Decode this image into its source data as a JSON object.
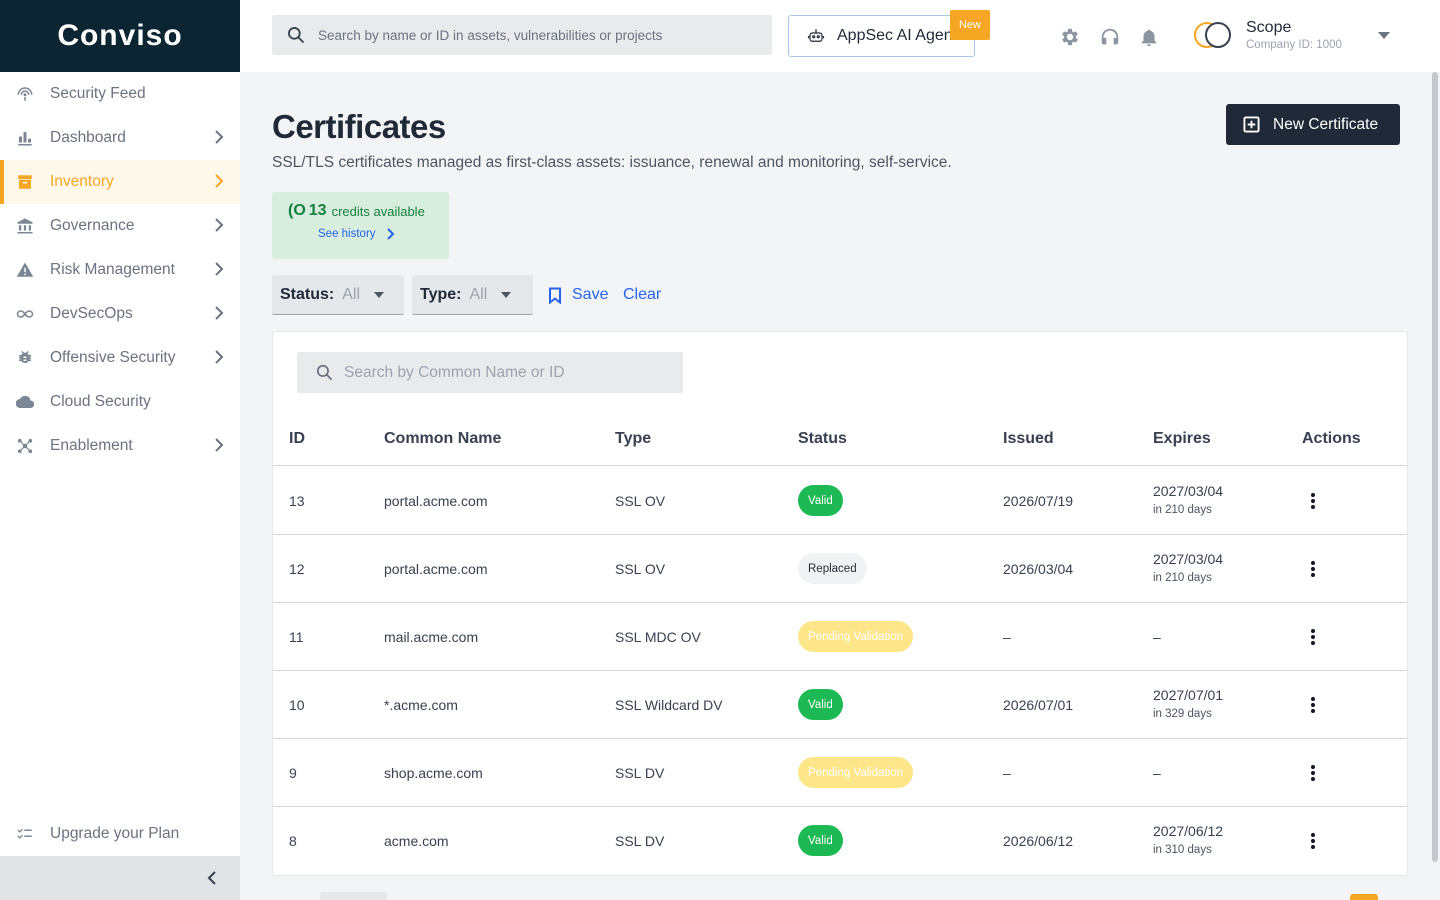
{
  "brand": {
    "logo_text": "Conviso",
    "accent": "#f5a623",
    "dark": "#0c2533"
  },
  "sidebar": {
    "items": [
      {
        "label": "Security Feed",
        "icon": "radar-icon",
        "has_chevron": false,
        "active": false
      },
      {
        "label": "Dashboard",
        "icon": "bar-chart-icon",
        "has_chevron": true,
        "active": false
      },
      {
        "label": "Inventory",
        "icon": "inventory-box-icon",
        "has_chevron": true,
        "active": true
      },
      {
        "label": "Governance",
        "icon": "bank-icon",
        "has_chevron": true,
        "active": false
      },
      {
        "label": "Risk Management",
        "icon": "warning-icon",
        "has_chevron": true,
        "active": false
      },
      {
        "label": "DevSecOps",
        "icon": "infinity-icon",
        "has_chevron": true,
        "active": false
      },
      {
        "label": "Offensive Security",
        "icon": "bug-icon",
        "has_chevron": true,
        "active": false
      },
      {
        "label": "Cloud Security",
        "icon": "cloud-icon",
        "has_chevron": false,
        "active": false
      },
      {
        "label": "Enablement",
        "icon": "hub-icon",
        "has_chevron": true,
        "active": false
      }
    ],
    "upgrade_label": "Upgrade your Plan"
  },
  "topbar": {
    "search_placeholder": "Search by name or ID in assets, vulnerabilities or projects",
    "ai_button_label": "AppSec AI Agent",
    "new_badge": "New",
    "org_name": "Scope",
    "org_id": "Company ID: 1000"
  },
  "page": {
    "title": "Certificates",
    "subtitle": "SSL/TLS certificates managed as first-class assets: issuance, renewal and monitoring, self-service.",
    "new_button_label": "New Certificate",
    "credits_icon": "(O",
    "credits_count": "13",
    "credits_label": "credits available",
    "credits_history": "See history"
  },
  "filters": {
    "status_key": "Status:",
    "status_value": "All",
    "type_key": "Type:",
    "type_value": "All",
    "save_label": "Save",
    "clear_label": "Clear"
  },
  "table": {
    "search_placeholder": "Search by Common Name or ID",
    "columns": [
      "ID",
      "Common Name",
      "Type",
      "Status",
      "Issued",
      "Expires",
      "Actions"
    ],
    "rows": [
      {
        "id": "13",
        "cn": "portal.acme.com",
        "type": "SSL OV",
        "status": "Valid",
        "status_kind": "valid",
        "issued": "2026/07/19",
        "expires": "2027/03/04",
        "expires_in": "in 210 days"
      },
      {
        "id": "12",
        "cn": "portal.acme.com",
        "type": "SSL OV",
        "status": "Replaced",
        "status_kind": "replaced",
        "issued": "2026/03/04",
        "expires": "2027/03/04",
        "expires_in": "in 210 days"
      },
      {
        "id": "11",
        "cn": "mail.acme.com",
        "type": "SSL MDC OV",
        "status": "Pending Validation",
        "status_kind": "pending",
        "issued": "–",
        "expires": "–",
        "expires_in": ""
      },
      {
        "id": "10",
        "cn": "*.acme.com",
        "type": "SSL Wildcard DV",
        "status": "Valid",
        "status_kind": "valid",
        "issued": "2026/07/01",
        "expires": "2027/07/01",
        "expires_in": "in 329 days"
      },
      {
        "id": "9",
        "cn": "shop.acme.com",
        "type": "SSL DV",
        "status": "Pending Validation",
        "status_kind": "pending",
        "issued": "–",
        "expires": "–",
        "expires_in": ""
      },
      {
        "id": "8",
        "cn": "acme.com",
        "type": "SSL DV",
        "status": "Valid",
        "status_kind": "valid",
        "issued": "2026/06/12",
        "expires": "2027/06/12",
        "expires_in": "in 310 days"
      }
    ]
  }
}
